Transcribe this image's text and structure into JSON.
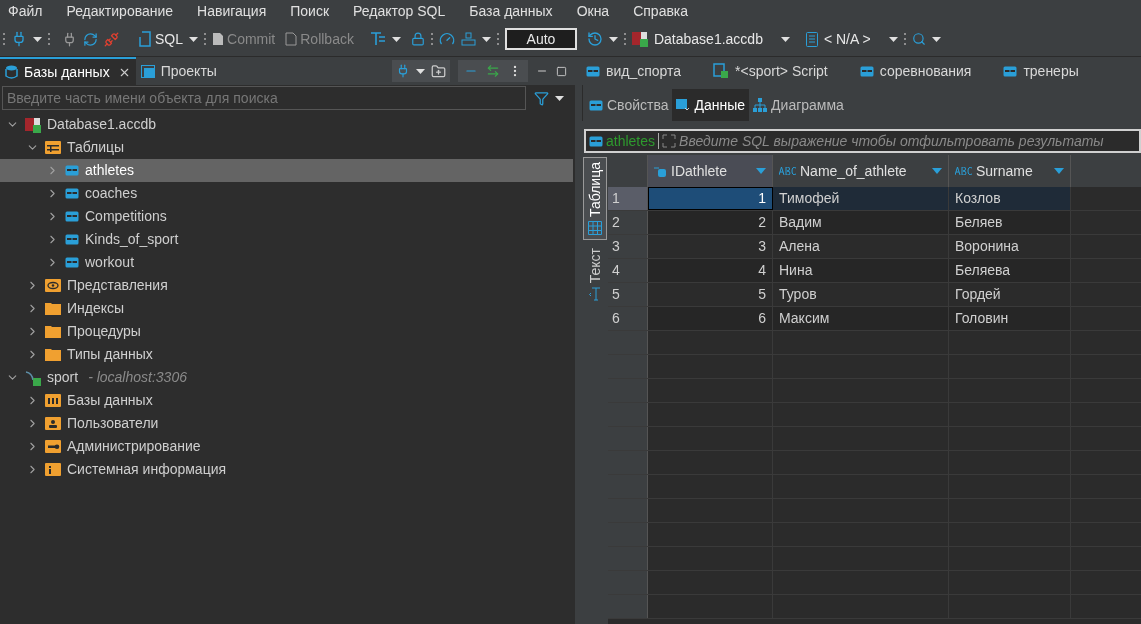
{
  "menu": [
    "Файл",
    "Редактирование",
    "Навигация",
    "Поиск",
    "Редактор SQL",
    "База данных",
    "Окна",
    "Справка"
  ],
  "toolbar": {
    "sql": {
      "label": "SQL"
    },
    "commit": {
      "label": "Commit",
      "disabled": true
    },
    "rollback": {
      "label": "Rollback",
      "disabled": true
    },
    "mode": "Auto",
    "datasource": "Database1.accdb",
    "schema": "< N/A >"
  },
  "left_panel": {
    "tabs": [
      {
        "label": "Базы данных",
        "selected": true,
        "kind": "databases"
      },
      {
        "label": "Проекты",
        "selected": false,
        "kind": "projects"
      }
    ],
    "search": {
      "placeholder": "Введите часть имени объекта для поиска"
    },
    "tree": [
      {
        "label": "Database1.accdb",
        "kind": "access",
        "expanded": true,
        "selected": false,
        "children": [
          {
            "label": "Таблицы",
            "kind": "tables",
            "expanded": true,
            "selected": false,
            "children": [
              {
                "label": "athletes",
                "kind": "table",
                "expanded": false,
                "selected": true
              },
              {
                "label": "coaches",
                "kind": "table",
                "expanded": false,
                "selected": false
              },
              {
                "label": "Competitions",
                "kind": "table",
                "expanded": false,
                "selected": false
              },
              {
                "label": "Kinds_of_sport",
                "kind": "table",
                "expanded": false,
                "selected": false
              },
              {
                "label": "workout",
                "kind": "table",
                "expanded": false,
                "selected": false
              }
            ]
          },
          {
            "label": "Представления",
            "kind": "views",
            "expanded": false,
            "selected": false
          },
          {
            "label": "Индексы",
            "kind": "folder",
            "expanded": false,
            "selected": false
          },
          {
            "label": "Процедуры",
            "kind": "folder",
            "expanded": false,
            "selected": false
          },
          {
            "label": "Типы данных",
            "kind": "folder",
            "expanded": false,
            "selected": false
          }
        ]
      },
      {
        "label": "sport",
        "note": "- localhost:3306",
        "kind": "mysql",
        "expanded": true,
        "selected": false,
        "children": [
          {
            "label": "Базы данных",
            "kind": "dbfolder",
            "expanded": false,
            "selected": false
          },
          {
            "label": "Пользователи",
            "kind": "users",
            "expanded": false,
            "selected": false
          },
          {
            "label": "Администрирование",
            "kind": "admin",
            "expanded": false,
            "selected": false
          },
          {
            "label": "Системная информация",
            "kind": "info",
            "expanded": false,
            "selected": false
          }
        ]
      }
    ]
  },
  "editor_tabs": [
    {
      "label": "вид_спорта",
      "kind": "table",
      "selected": false
    },
    {
      "label": "*<sport> Script",
      "kind": "script",
      "selected": false
    },
    {
      "label": "соревнования",
      "kind": "table",
      "selected": false
    },
    {
      "label": "тренеры",
      "kind": "table",
      "selected": false
    }
  ],
  "sub_tabs": [
    {
      "label": "Свойства",
      "kind": "properties",
      "selected": false
    },
    {
      "label": "Данные",
      "kind": "data",
      "selected": true
    },
    {
      "label": "Диаграмма",
      "kind": "diagram",
      "selected": false
    }
  ],
  "filter": {
    "table": "athletes",
    "placeholder": "Введите SQL выражение чтобы отфильтровать результаты"
  },
  "side_tabs": [
    {
      "label": "Таблица",
      "kind": "grid",
      "selected": true
    },
    {
      "label": "Текст",
      "kind": "text",
      "selected": false
    }
  ],
  "grid": {
    "columns": [
      {
        "label": "IDathlete",
        "kind": "number"
      },
      {
        "label": "Name_of_athlete",
        "kind": "text"
      },
      {
        "label": "Surname",
        "kind": "text"
      }
    ],
    "rows": [
      {
        "num": "1",
        "cells": [
          "1",
          "Тимофей",
          "Козлов"
        ],
        "selected": true
      },
      {
        "num": "2",
        "cells": [
          "2",
          "Вадим",
          "Беляев"
        ],
        "selected": false
      },
      {
        "num": "3",
        "cells": [
          "3",
          "Алена",
          "Воронина"
        ],
        "selected": false
      },
      {
        "num": "4",
        "cells": [
          "4",
          "Нина",
          "Беляева"
        ],
        "selected": false
      },
      {
        "num": "5",
        "cells": [
          "5",
          "Туров",
          "Гордей"
        ],
        "selected": false
      },
      {
        "num": "6",
        "cells": [
          "6",
          "Максим",
          "Головин"
        ],
        "selected": false
      }
    ]
  }
}
